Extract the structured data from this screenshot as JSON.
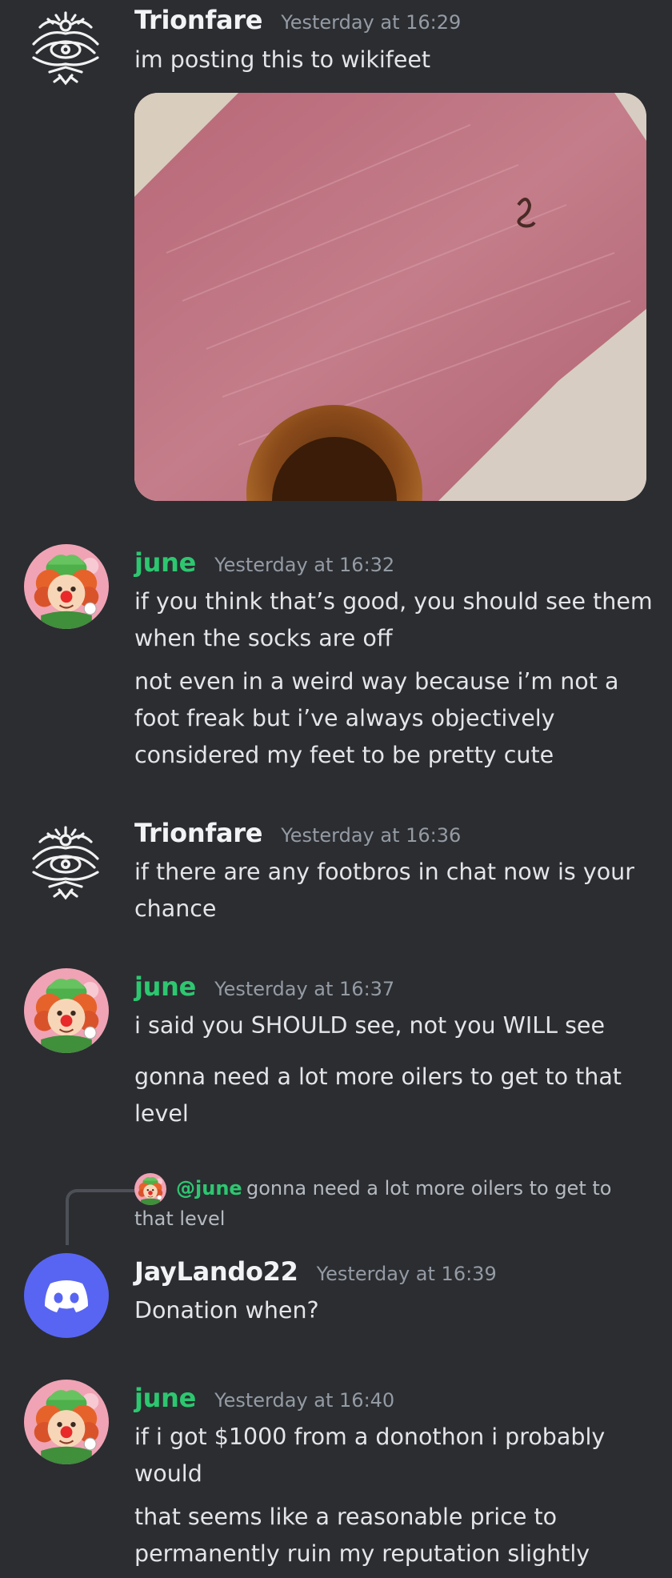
{
  "messages": [
    {
      "username": "Trionfare",
      "timestamp": "Yesterday at 16:29",
      "avatar": "occult-eye-icon",
      "lines": [
        "im posting this to wikifeet"
      ],
      "attachment": "photo of sock on pink mat"
    },
    {
      "username": "june",
      "timestamp": "Yesterday at 16:32",
      "avatar": "clown-avatar",
      "lines": [
        "if you think that’s good, you should see them",
        "when the socks are off",
        "not even in a weird way because i’m not a",
        "foot freak but i’ve always objectively",
        "considered my feet to be pretty cute"
      ]
    },
    {
      "username": "Trionfare",
      "timestamp": "Yesterday at 16:36",
      "avatar": "occult-eye-icon",
      "lines": [
        "if there are any footbros in chat now is your",
        "chance"
      ]
    },
    {
      "username": "june",
      "timestamp": "Yesterday at 16:37",
      "avatar": "clown-avatar",
      "lines": [
        "i said you SHOULD see, not you WILL see",
        "gonna need a lot more oilers to get to that",
        "level"
      ]
    },
    {
      "username": "JayLando22",
      "timestamp": "Yesterday at 16:39",
      "avatar": "discord-default-avatar",
      "reply": {
        "mention": "@june",
        "text_line1": "gonna need a lot more oilers to get to",
        "text_line2": "that level"
      },
      "lines": [
        "Donation when?"
      ]
    },
    {
      "username": "june",
      "timestamp": "Yesterday at 16:40",
      "avatar": "clown-avatar",
      "lines": [
        "if i got $1000 from a donothon i probably",
        "would",
        "that seems like a reasonable price to",
        "permanently ruin my reputation slightly"
      ]
    }
  ],
  "colors": {
    "background": "#2b2d31",
    "username_green": "#2dc770",
    "discord_blurple": "#5865f2"
  }
}
